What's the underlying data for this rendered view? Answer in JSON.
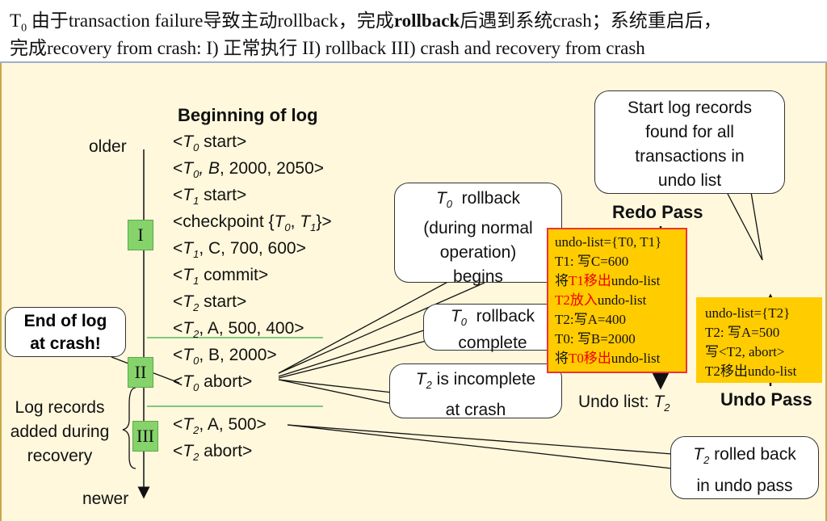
{
  "header": {
    "line1_a": "T",
    "line1_sub": "0",
    "line1_b": " 由于transaction failure导致主动rollback，完成",
    "line1_bold": "rollback",
    "line1_c": "后遇到系统crash；系统重启后，",
    "line2": "完成recovery from crash: I) 正常执行  II) rollback    III) crash and recovery from crash"
  },
  "log": {
    "title": "Beginning of log",
    "older": "older",
    "newer": "newer",
    "end_of_log": [
      "End of log",
      "at crash!"
    ],
    "added": [
      "Log records",
      "added during",
      "recovery"
    ],
    "phases": [
      "I",
      "II",
      "III"
    ]
  },
  "bubbles": {
    "rollback": [
      "rollback",
      "(during normal",
      "operation)",
      "begins"
    ],
    "complete": [
      "rollback",
      "complete"
    ],
    "incomplete": [
      "is incomplete",
      "at crash"
    ],
    "start": [
      "Start log records",
      "found for all",
      "transactions in",
      "undo list"
    ],
    "rolled": [
      "rolled back",
      "in undo pass"
    ]
  },
  "redo": {
    "title": "Redo Pass",
    "lines": [
      {
        "text": "undo-list={T0, T1}",
        "red": ""
      },
      {
        "text": "T1: 写C=600",
        "red": ""
      },
      {
        "pre": "将",
        "red": "T1移出",
        "post": "undo-list"
      },
      {
        "pre": "",
        "red": "T2放入",
        "post": "undo-list"
      },
      {
        "text": "T2:写A=400",
        "red": ""
      },
      {
        "text": "T0:  写B=2000",
        "red": ""
      },
      {
        "pre": "将",
        "red": "T0移出",
        "post": "undo-list"
      }
    ]
  },
  "undo": {
    "title": "Undo Pass",
    "list_label": "Undo list: ",
    "list_value": "T",
    "list_sub": "2",
    "lines": [
      "undo-list={T2}",
      "T2: 写A=500",
      "写<T2, abort>",
      "T2移出undo-list"
    ]
  },
  "colors": {
    "box_fill": "#ffcc00",
    "box_border": "#ee3333",
    "phase_green": "#86d36b",
    "red_text": "#ee0000",
    "background": "#fff8dc"
  }
}
